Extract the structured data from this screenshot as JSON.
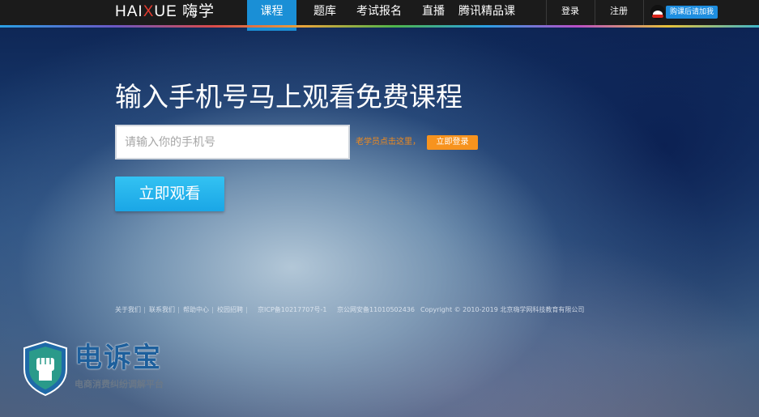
{
  "header": {
    "logo_text": "HAIXUE 嗨学",
    "logo_main": "HAI",
    "logo_x": "X",
    "logo_rest": "UE 嗨学",
    "nav": [
      {
        "label": "课程",
        "active": true
      },
      {
        "label": "题库",
        "active": false
      },
      {
        "label": "考试报名",
        "active": false
      },
      {
        "label": "直播",
        "active": false
      },
      {
        "label": "腾讯精品课",
        "active": false
      }
    ],
    "login_label": "登录",
    "register_label": "注册",
    "qq_button_label": "购课后请加我"
  },
  "hero": {
    "headline": "输入手机号马上观看免费课程",
    "phone_placeholder": "请输入你的手机号",
    "old_student_text": "老学员点击这里，",
    "login_now_label": "立即登录",
    "watch_button_label": "立即观看"
  },
  "footer": {
    "about": "关于我们",
    "contact": "联系我们",
    "help": "帮助中心",
    "jobs": "校园招聘",
    "icp": "京ICP备10217707号-1",
    "police": "京公网安备11010502436",
    "copyright": "Copyright © 2010-2019 北京嗨学网科技教育有限公司",
    "separator": "|"
  },
  "watermark": {
    "title": "电诉宝",
    "subtitle": "电商消费纠纷调解平台"
  },
  "colors": {
    "topbar": "#1b1b1b",
    "nav_active": "#1a8fd6",
    "accent_orange": "#f7931e",
    "watch_button": "#1aa6e6"
  }
}
